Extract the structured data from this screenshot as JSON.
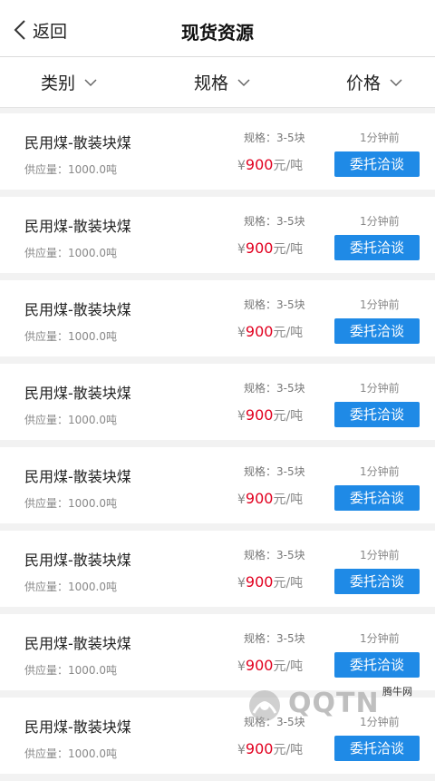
{
  "header": {
    "back_label": "返回",
    "title": "现货资源"
  },
  "filters": [
    {
      "label": "类别"
    },
    {
      "label": "规格"
    },
    {
      "label": "价格"
    }
  ],
  "items": [
    {
      "name": "民用煤-散装块煤",
      "supply": "供应量：1000.0吨",
      "spec": "规格：3-5块",
      "currency": "¥",
      "price": "900",
      "unit": "元/吨",
      "time": "1分钟前",
      "button": "委托洽谈"
    },
    {
      "name": "民用煤-散装块煤",
      "supply": "供应量：1000.0吨",
      "spec": "规格：3-5块",
      "currency": "¥",
      "price": "900",
      "unit": "元/吨",
      "time": "1分钟前",
      "button": "委托洽谈"
    },
    {
      "name": "民用煤-散装块煤",
      "supply": "供应量：1000.0吨",
      "spec": "规格：3-5块",
      "currency": "¥",
      "price": "900",
      "unit": "元/吨",
      "time": "1分钟前",
      "button": "委托洽谈"
    },
    {
      "name": "民用煤-散装块煤",
      "supply": "供应量：1000.0吨",
      "spec": "规格：3-5块",
      "currency": "¥",
      "price": "900",
      "unit": "元/吨",
      "time": "1分钟前",
      "button": "委托洽谈"
    },
    {
      "name": "民用煤-散装块煤",
      "supply": "供应量：1000.0吨",
      "spec": "规格：3-5块",
      "currency": "¥",
      "price": "900",
      "unit": "元/吨",
      "time": "1分钟前",
      "button": "委托洽谈"
    },
    {
      "name": "民用煤-散装块煤",
      "supply": "供应量：1000.0吨",
      "spec": "规格：3-5块",
      "currency": "¥",
      "price": "900",
      "unit": "元/吨",
      "time": "1分钟前",
      "button": "委托洽谈"
    },
    {
      "name": "民用煤-散装块煤",
      "supply": "供应量：1000.0吨",
      "spec": "规格：3-5块",
      "currency": "¥",
      "price": "900",
      "unit": "元/吨",
      "time": "1分钟前",
      "button": "委托洽谈"
    },
    {
      "name": "民用煤-散装块煤",
      "supply": "供应量：1000.0吨",
      "spec": "规格：3-5块",
      "currency": "¥",
      "price": "900",
      "unit": "元/吨",
      "time": "1分钟前",
      "button": "委托洽谈"
    }
  ],
  "watermark": {
    "text": "QQTN",
    "small": "腾牛网"
  },
  "colors": {
    "accent": "#1f8ae6",
    "price": "#e1001f"
  },
  "icons": {
    "back": "chevron-left-icon",
    "dropdown": "chevron-down-icon",
    "watermark_logo": "qqtn-logo-icon"
  }
}
